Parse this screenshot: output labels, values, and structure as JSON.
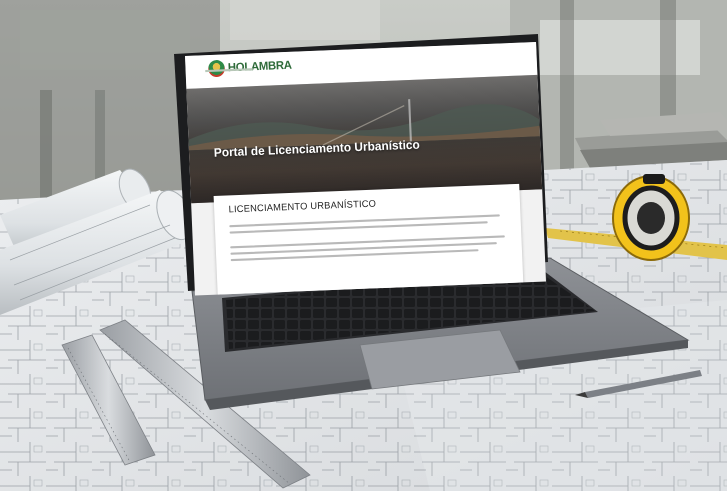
{
  "site": {
    "logo_text": "HOLAMBRA",
    "nav": [
      "",
      "",
      "",
      ""
    ],
    "hero_title": "Portal de Licenciamento Urbanístico",
    "hero_subtitle": "",
    "section_title": "LICENCIAMENTO URBANÍSTICO"
  },
  "colors": {
    "brand_green": "#2f6b3a",
    "laptop_body": "#8a8d92",
    "tape_yellow": "#f2c21b"
  },
  "icons": [
    "logo-mark-icon"
  ]
}
